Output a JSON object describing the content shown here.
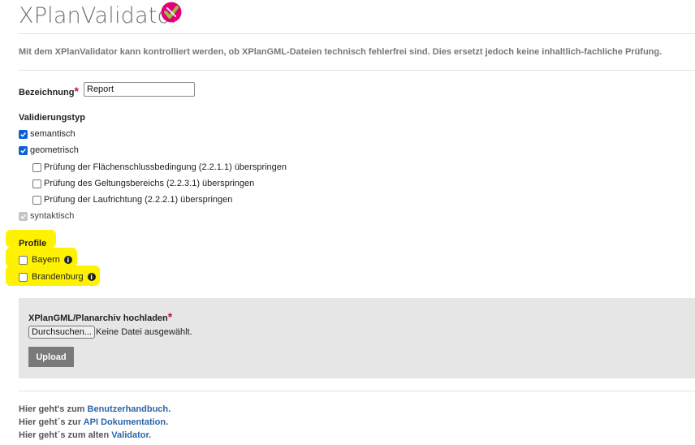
{
  "app_title": "XPlanValidator",
  "intro_text": "Mit dem XPlanValidator kann kontrolliert werden, ob XPlanGML-Dateien technisch fehlerfrei sind. Dies ersetzt jedoch keine inhaltlich-fachliche Prüfung.",
  "bezeichnung": {
    "label": "Bezeichnung",
    "required_mark": "*",
    "value": "Report"
  },
  "validierungstyp": {
    "heading": "Validierungstyp",
    "semantisch": {
      "label": "semantisch",
      "checked": true
    },
    "geometrisch": {
      "label": "geometrisch",
      "checked": true
    },
    "skip_options": [
      {
        "label": "Prüfung der Flächenschlussbedingung (2.2.1.1) überspringen",
        "checked": false
      },
      {
        "label": "Prüfung des Geltungsbereichs (2.2.3.1) überspringen",
        "checked": false
      },
      {
        "label": "Prüfung der Laufrichtung (2.2.2.1) überspringen",
        "checked": false
      }
    ],
    "syntaktisch": {
      "label": "syntaktisch",
      "checked": true,
      "disabled": true
    }
  },
  "profile": {
    "heading": "Profile",
    "items": [
      {
        "label": "Bayern",
        "checked": false
      },
      {
        "label": "Brandenburg",
        "checked": false
      }
    ],
    "info_icon": "i",
    "highlight_color": "#fff200"
  },
  "upload": {
    "heading": "XPlanGML/Planarchiv hochladen",
    "required_mark": "*",
    "browse_label": "Durchsuchen...",
    "no_file_text": "Keine Datei ausgewählt.",
    "upload_label": "Upload"
  },
  "footer": [
    {
      "prefix": "Hier geht's zum ",
      "link": "Benutzerhandbuch",
      "suffix": "."
    },
    {
      "prefix": "Hier geht´s zur ",
      "link": "API Dokumentation",
      "suffix": "."
    },
    {
      "prefix": "Hier geht´s zum alten ",
      "link": "Validator",
      "suffix": "."
    }
  ],
  "colors": {
    "accent_blue": "#0b62cf",
    "link_blue": "#2a66a8",
    "required_red": "#c8102e",
    "logo_magenta": "#e2007a",
    "logo_green": "#8cc63f"
  },
  "icons": {
    "logo": "xplan-logo-icon",
    "checkmark": "checkmark-icon",
    "info": "info-circle-icon"
  }
}
